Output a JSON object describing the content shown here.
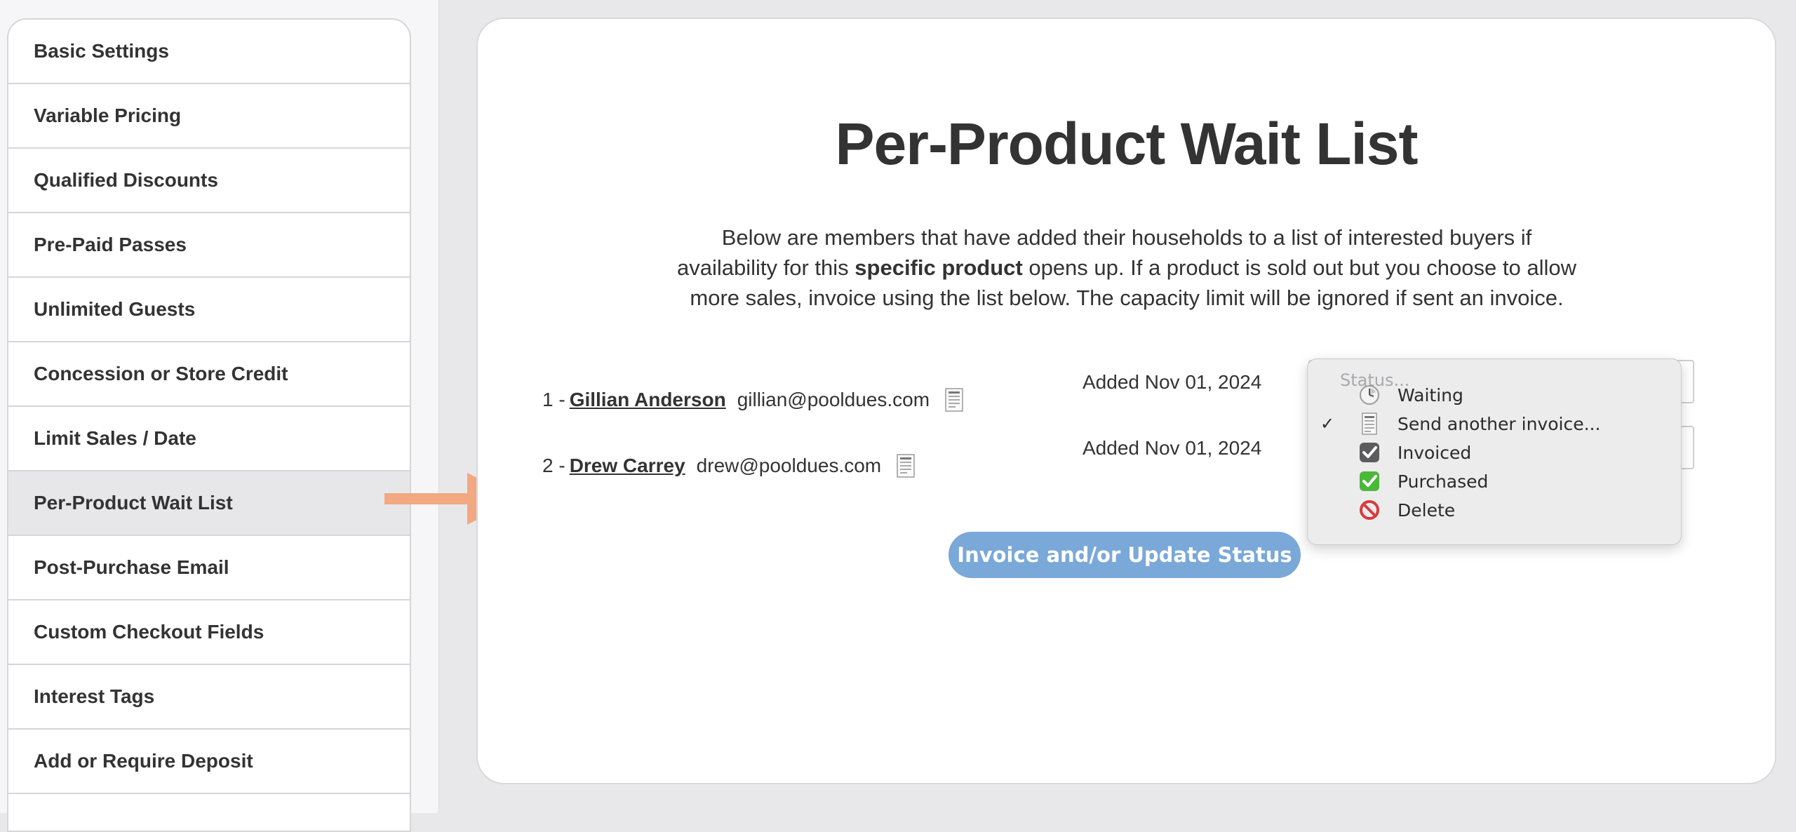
{
  "sidebar": {
    "items": [
      {
        "label": "Basic Settings"
      },
      {
        "label": "Variable Pricing"
      },
      {
        "label": "Qualified Discounts"
      },
      {
        "label": "Pre-Paid Passes"
      },
      {
        "label": "Unlimited Guests"
      },
      {
        "label": "Concession or Store Credit"
      },
      {
        "label": "Limit Sales / Date"
      },
      {
        "label": "Per-Product Wait List",
        "active": true
      },
      {
        "label": "Post-Purchase Email"
      },
      {
        "label": "Custom Checkout Fields"
      },
      {
        "label": "Interest Tags"
      },
      {
        "label": "Add or Require Deposit"
      }
    ]
  },
  "main": {
    "title": "Per-Product Wait List",
    "intro_part1": "Below are members that have added their households to a list of interested buyers if availability for this ",
    "intro_bold": "specific product",
    "intro_part2": " opens up. If a product is sold out but you choose to allow more sales, invoice using the list below. The capacity limit will be ignored if sent an invoice.",
    "waitlist": [
      {
        "index": "1 -",
        "name": "Gillian Anderson",
        "email": "gillian@pooldues.com",
        "added": "Added Nov 01, 2024"
      },
      {
        "index": "2 -",
        "name": "Drew Carrey",
        "email": "drew@pooldues.com",
        "added": "Added Nov 01, 2024"
      }
    ],
    "submit_label": "Invoice and/or Update Status"
  },
  "status_dropdown": {
    "header": "Status...",
    "options": [
      {
        "label": "Waiting",
        "icon": "clock-icon",
        "checked": false
      },
      {
        "label": "Send another invoice...",
        "icon": "receipt-icon",
        "checked": true
      },
      {
        "label": "Invoiced",
        "icon": "checkbox-checked-icon",
        "checked": false
      },
      {
        "label": "Purchased",
        "icon": "green-check-icon",
        "checked": false
      },
      {
        "label": "Delete",
        "icon": "prohibited-icon",
        "checked": false
      }
    ],
    "check_glyph": "✓"
  },
  "colors": {
    "accent_button": "#7aa8d8",
    "arrow": "#f2a880",
    "active_sidebar": "#e7e7e9"
  }
}
